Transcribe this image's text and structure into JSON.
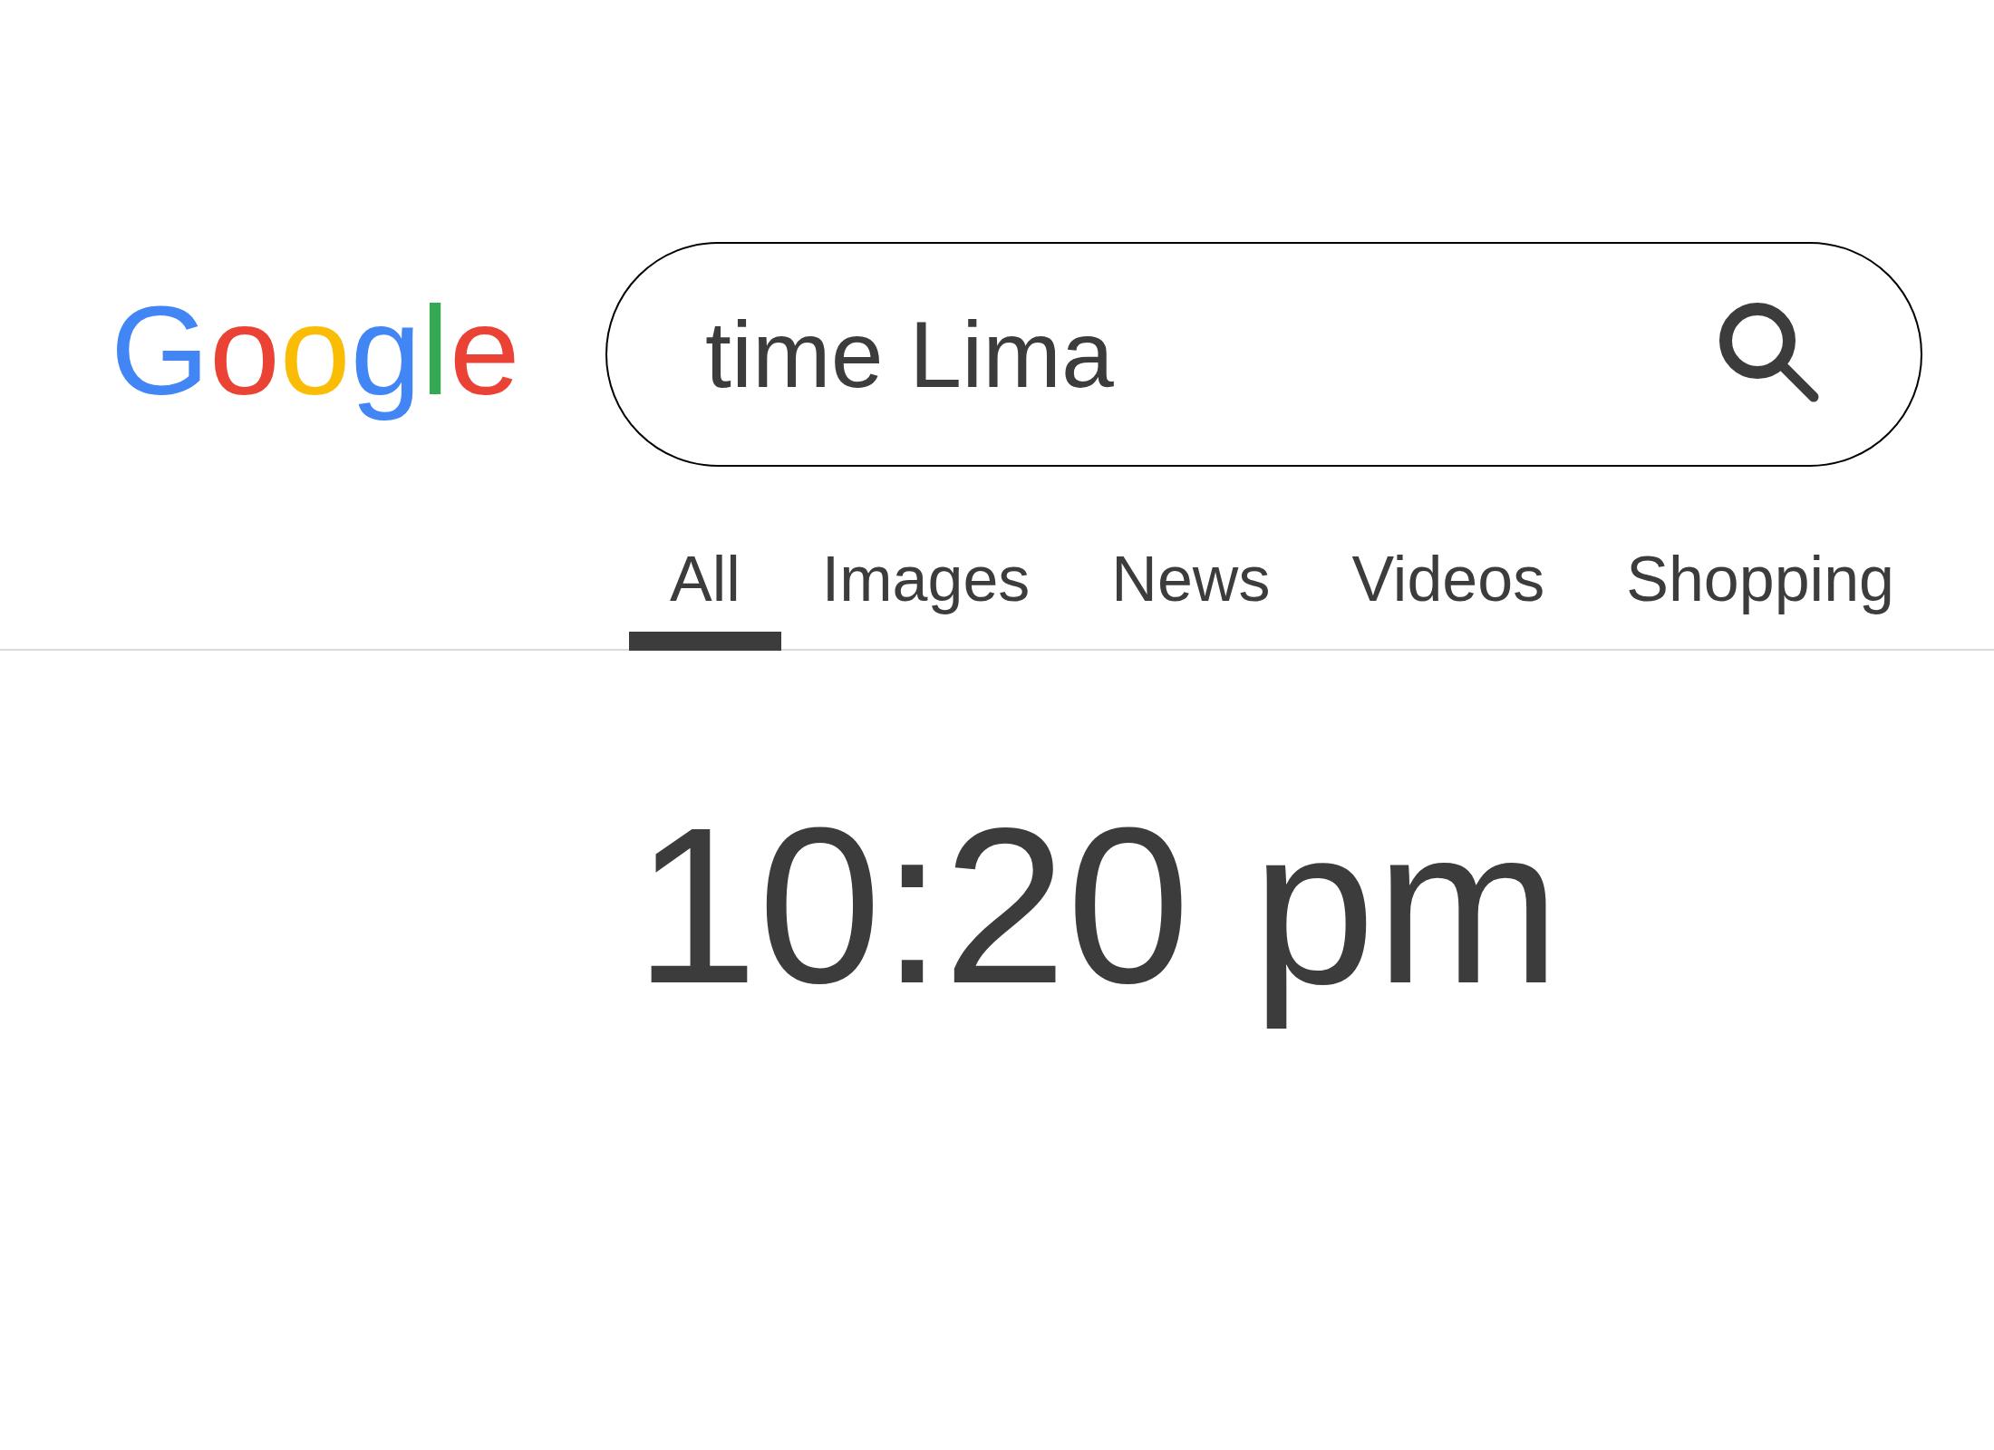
{
  "header": {
    "logo": "Google",
    "search": {
      "value": "time Lima"
    }
  },
  "tabs": [
    {
      "label": "All",
      "selected": true
    },
    {
      "label": "Images",
      "selected": false
    },
    {
      "label": "News",
      "selected": false
    },
    {
      "label": "Videos",
      "selected": false
    },
    {
      "label": "Shopping",
      "selected": false
    }
  ],
  "result": {
    "time": "10:20 pm"
  }
}
